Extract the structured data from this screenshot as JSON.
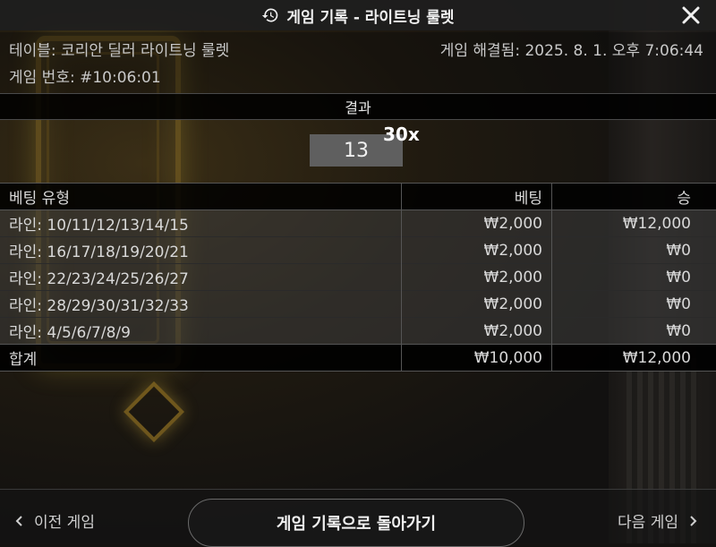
{
  "window": {
    "title": "게임 기록 - 라이트닝 룰렛",
    "history_icon": "history-icon",
    "close_icon": "close-icon"
  },
  "info": {
    "table": "테이블: 코리안 딜러 라이트닝 룰렛",
    "game_number": "게임 번호: #10:06:01",
    "resolved": "게임 해결됨: 2025. 8. 1. 오후 7:06:44"
  },
  "result": {
    "header": "결과",
    "number": "13",
    "multiplier": "30x",
    "number_color": "#5f5f5f"
  },
  "bets": {
    "columns": [
      "베팅 유형",
      "베팅",
      "승"
    ],
    "rows": [
      {
        "type": "라인: 10/11/12/13/14/15",
        "bet": "₩2,000",
        "win": "₩12,000"
      },
      {
        "type": "라인: 16/17/18/19/20/21",
        "bet": "₩2,000",
        "win": "₩0"
      },
      {
        "type": "라인: 22/23/24/25/26/27",
        "bet": "₩2,000",
        "win": "₩0"
      },
      {
        "type": "라인: 28/29/30/31/32/33",
        "bet": "₩2,000",
        "win": "₩0"
      },
      {
        "type": "라인: 4/5/6/7/8/9",
        "bet": "₩2,000",
        "win": "₩0"
      }
    ],
    "total": {
      "label": "합계",
      "bet": "₩10,000",
      "win": "₩12,000"
    }
  },
  "footer": {
    "prev": "이전 게임",
    "back": "게임 기록으로 돌아가기",
    "next": "다음 게임",
    "prev_icon": "chevron-left-icon",
    "next_icon": "chevron-right-icon"
  }
}
